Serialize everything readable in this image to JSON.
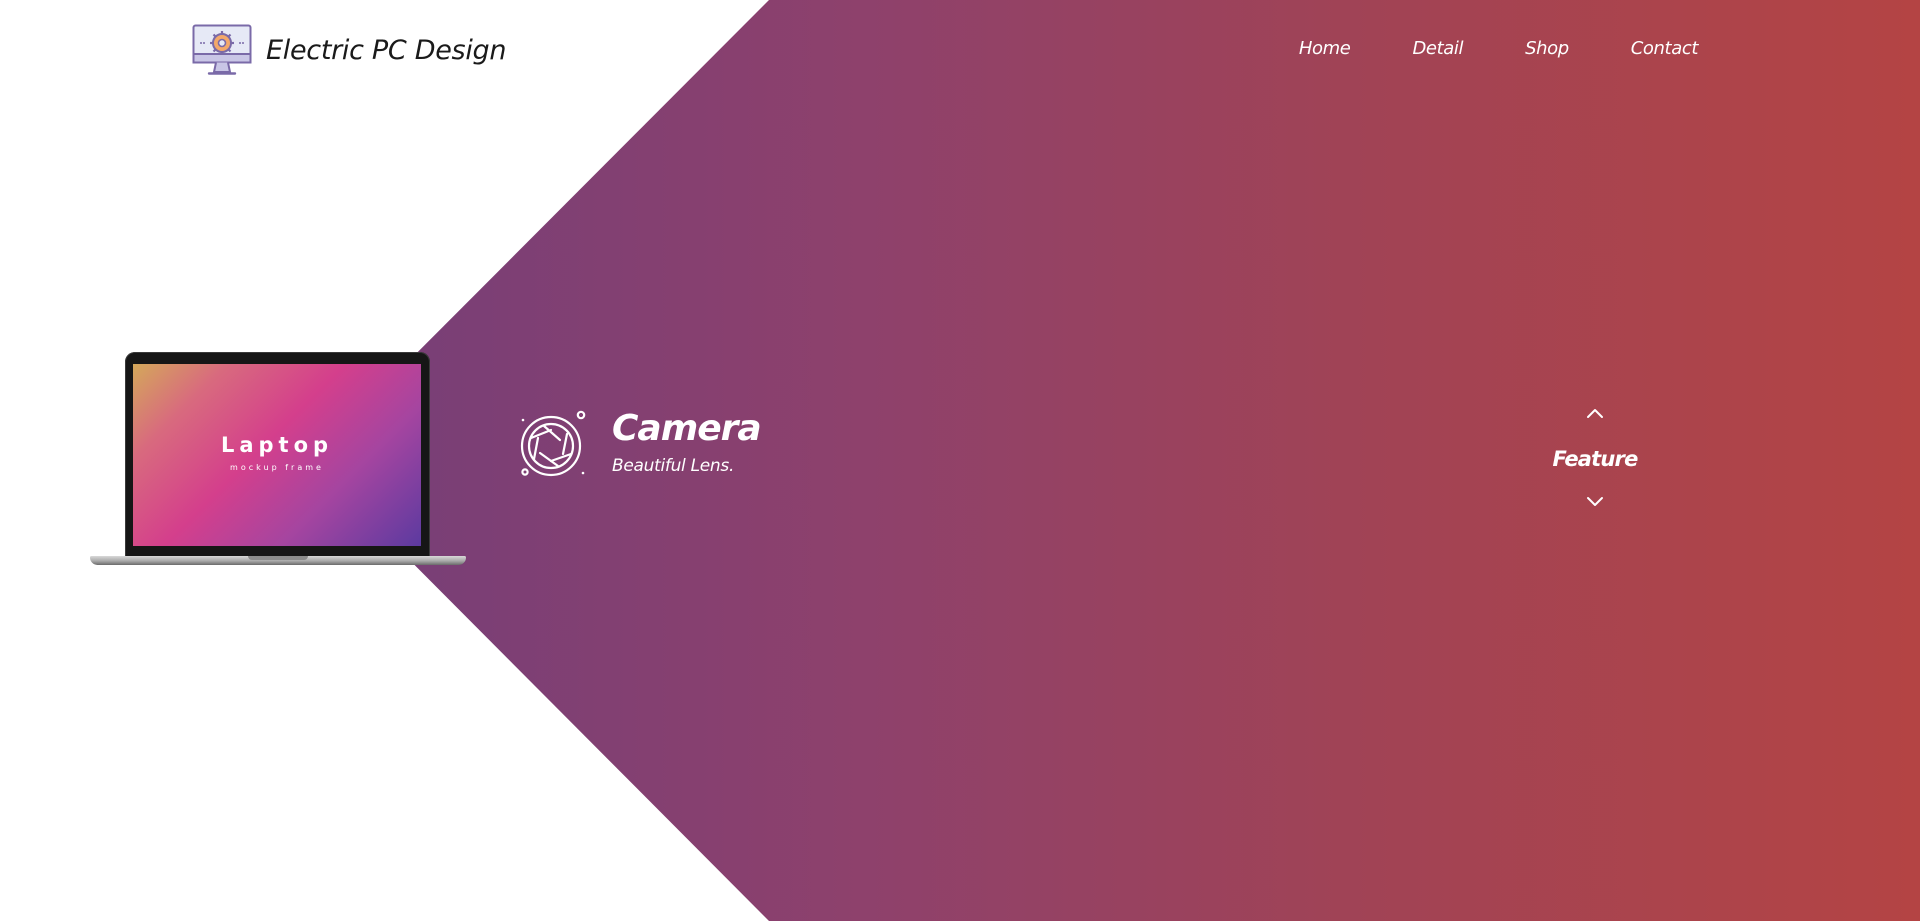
{
  "header": {
    "brand_name": "Electric PC Design",
    "logo_icon": "monitor-gear-icon"
  },
  "nav": {
    "items": [
      {
        "label": "Home"
      },
      {
        "label": "Detail"
      },
      {
        "label": "Shop"
      },
      {
        "label": "Contact"
      }
    ]
  },
  "laptop": {
    "screen_title": "Laptop",
    "screen_subtitle": "mockup frame"
  },
  "feature": {
    "icon": "camera-aperture-icon",
    "title": "Camera",
    "subtitle": "Beautiful Lens.",
    "switcher_label": "Feature",
    "up_icon": "chevron-up-icon",
    "down_icon": "chevron-down-icon"
  },
  "colors": {
    "gradient_start": "#6a3d7a",
    "gradient_end": "#b44444",
    "text_light": "#ffffff",
    "brand_text": "#1a1a1a"
  }
}
